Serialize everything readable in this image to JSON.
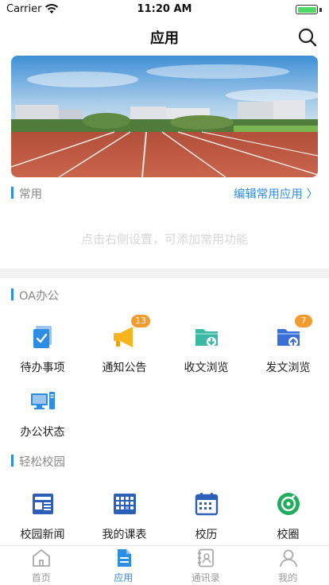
{
  "status_bar": {
    "carrier": "Carrier",
    "time": "11:20 AM"
  },
  "nav": {
    "title": "应用"
  },
  "common": {
    "title": "常用",
    "edit_label": "编辑常用应用 〉",
    "empty_hint": "点击右侧设置，可添加常用功能"
  },
  "oa": {
    "title": "OA办公",
    "items": [
      {
        "label": "待办事项",
        "icon": "todo-icon",
        "color": "#2d8de3"
      },
      {
        "label": "通知公告",
        "icon": "megaphone-icon",
        "color": "#f6b51f",
        "badge": "13"
      },
      {
        "label": "收文浏览",
        "icon": "folder-download-icon",
        "color": "#3cb9a4"
      },
      {
        "label": "发文浏览",
        "icon": "folder-upload-icon",
        "color": "#3a6fd8",
        "badge": "7"
      },
      {
        "label": "办公状态",
        "icon": "computer-icon",
        "color": "#2d8de3"
      }
    ]
  },
  "campus": {
    "title": "轻松校园",
    "items": [
      {
        "label": "校园新闻",
        "icon": "news-icon",
        "color": "#2b5fb8"
      },
      {
        "label": "我的课表",
        "icon": "schedule-grid-icon",
        "color": "#2b5fb8"
      },
      {
        "label": "校历",
        "icon": "calendar-icon",
        "color": "#2b5fb8"
      },
      {
        "label": "校圈",
        "icon": "compass-icon",
        "color": "#1fae5b"
      }
    ]
  },
  "tabs": [
    {
      "label": "首页",
      "icon": "home-icon",
      "active": false
    },
    {
      "label": "应用",
      "icon": "app-document-icon",
      "active": true
    },
    {
      "label": "通讯录",
      "icon": "contacts-icon",
      "active": false
    },
    {
      "label": "我的",
      "icon": "person-icon",
      "active": false
    }
  ]
}
